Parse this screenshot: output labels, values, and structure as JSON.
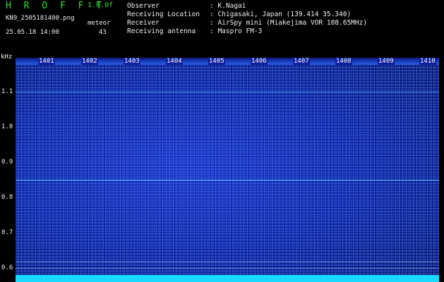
{
  "header": {
    "logo": "H R O F F T",
    "version": "1.0.0f",
    "filename": "KN9_2505181400.png",
    "meteor_label": "meteor",
    "datetime": "25.05.18 14:00",
    "meteor_count": "43"
  },
  "info": {
    "observer_label": "Observer",
    "observer_value": ": K.Nagai",
    "location_label": "Receiving Location",
    "location_value": ": Chigasaki, Japan (139.414 35.340)",
    "receiver_label": "Receiver",
    "receiver_value": ": AirSpy mini (Miakejima VOR 108.65MHz)",
    "antenna_label": "Receiving antenna",
    "antenna_value": ": Maspro FM-3"
  },
  "axis": {
    "unit": "kHz",
    "y_ticks": [
      "1.1",
      "1.0",
      "0.9",
      "0.8",
      "0.7",
      "0.6"
    ],
    "hour_labels": [
      "1401",
      "1402",
      "1403",
      "1404",
      "1405",
      "1406",
      "1407",
      "1408",
      "1409",
      "1410"
    ]
  },
  "colors": {
    "background": "#000000",
    "spectrum": "#0d1f9e",
    "carrier_line": "#5ad0ff",
    "bottom_band": "#18d9ff",
    "logo": "#2fe02f"
  }
}
